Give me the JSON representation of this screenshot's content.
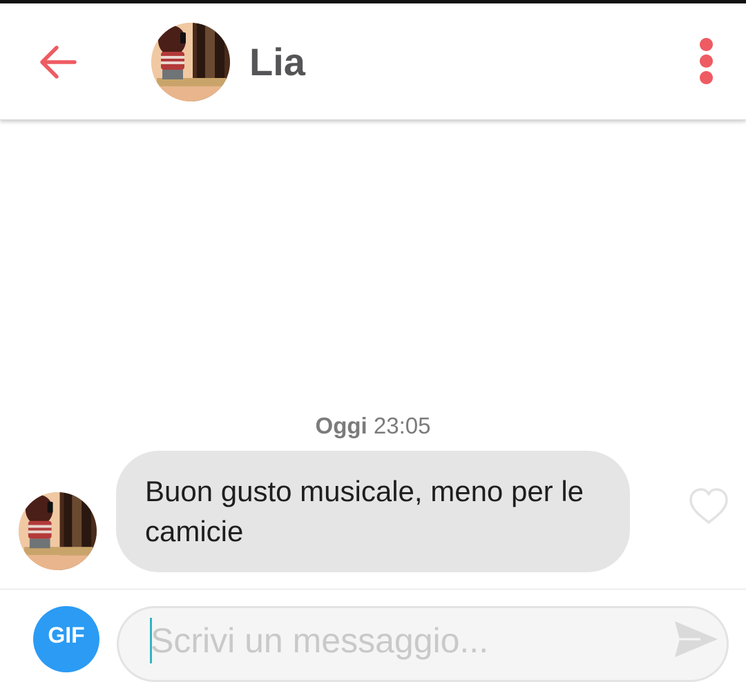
{
  "header": {
    "contact_name": "Lia",
    "back_icon": "arrow-left-icon",
    "menu_icon": "vertical-dots-icon",
    "accent_color": "#ee5b62"
  },
  "conversation": {
    "timestamp": {
      "day": "Oggi",
      "time": "23:05"
    },
    "messages": [
      {
        "sender": "Lia",
        "text": "Buon gusto musicale, meno per le camicie",
        "liked": false
      }
    ]
  },
  "composer": {
    "gif_label": "GIF",
    "placeholder": "Scrivi un messaggio...",
    "value": "",
    "send_icon": "send-icon",
    "gif_color": "#2b9bf4"
  }
}
